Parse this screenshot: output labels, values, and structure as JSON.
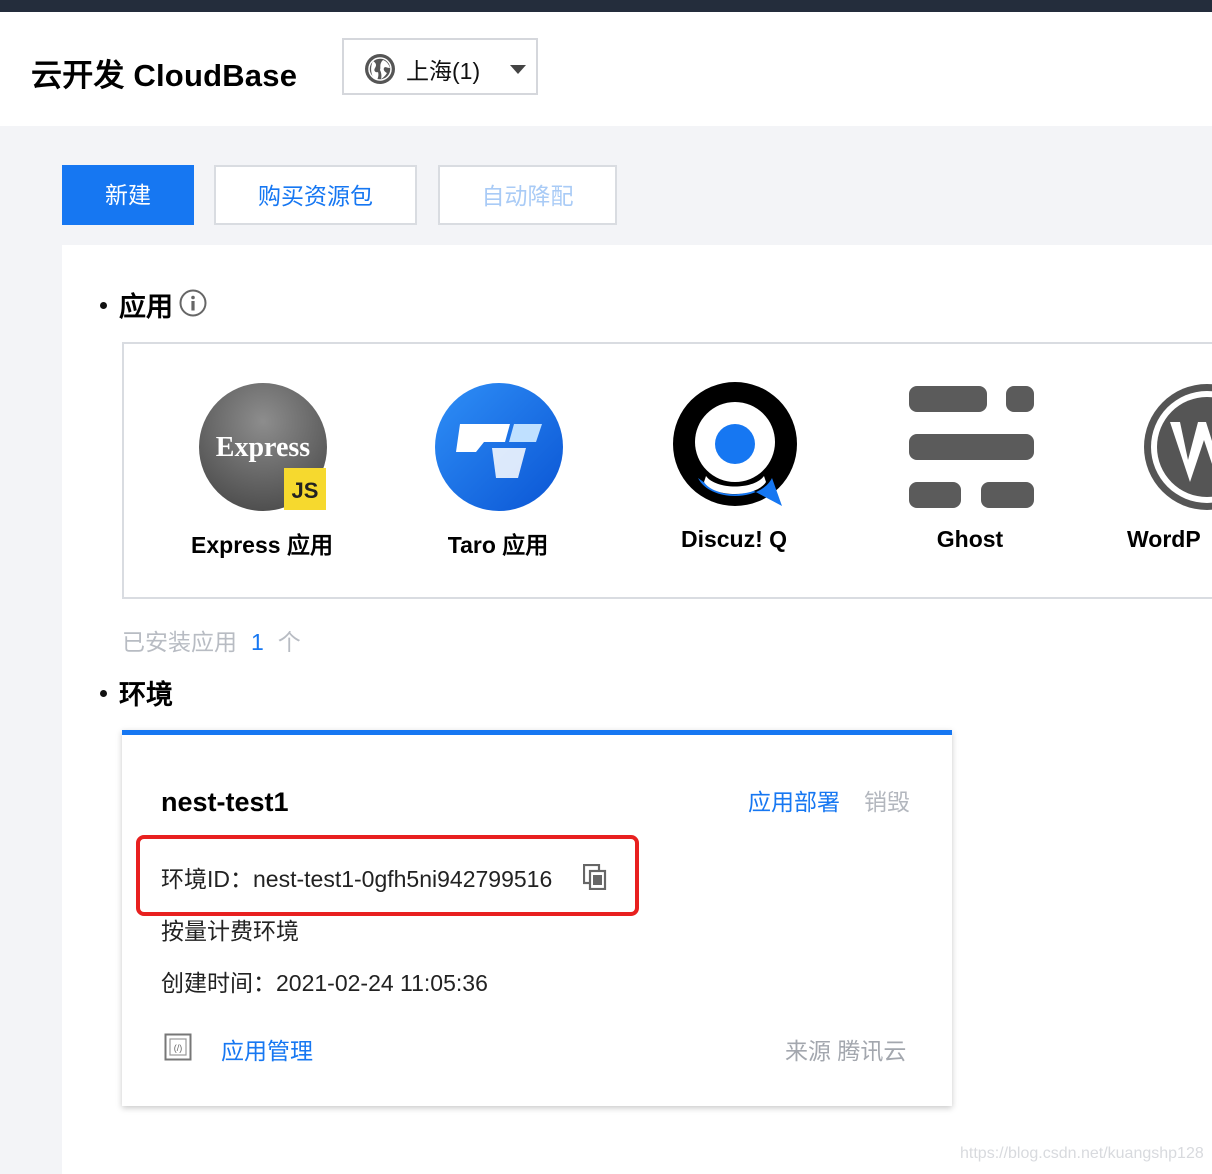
{
  "header": {
    "title": "云开发 CloudBase",
    "region": {
      "label": "上海(1)",
      "icon": "globe-icon"
    }
  },
  "toolbar": {
    "new_label": "新建",
    "buy_label": "购买资源包",
    "auto_label": "自动降配"
  },
  "apps_section": {
    "title": "应用",
    "apps": [
      {
        "name": "Express 应用",
        "logo_text": "Express",
        "badge": "JS"
      },
      {
        "name": "Taro 应用"
      },
      {
        "name": "Discuz! Q"
      },
      {
        "name": "Ghost"
      },
      {
        "name": "WordP"
      }
    ],
    "installed_label": "已安装应用",
    "installed_count": "1",
    "installed_unit": "个"
  },
  "env_section": {
    "title": "环境",
    "env": {
      "name": "nest-test1",
      "deploy_label": "应用部署",
      "destroy_label": "销毁",
      "id_label": "环境ID：",
      "id_value": "nest-test1-0gfh5ni942799516",
      "billing": "按量计费环境",
      "created_label": "创建时间：",
      "created_value": "2021-02-24 11:05:36",
      "manage_label": "应用管理",
      "source_label": "来源",
      "source_value": "腾讯云"
    }
  },
  "watermark": "https://blog.csdn.net/kuangshp128",
  "colors": {
    "accent": "#1677f2",
    "highlight": "#e8201f",
    "topbar": "#242d3c"
  }
}
